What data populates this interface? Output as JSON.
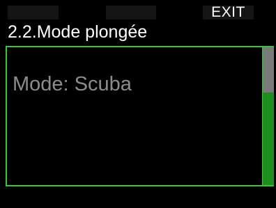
{
  "softkeys": {
    "left_label": "",
    "middle_label": "",
    "right_label": "EXIT"
  },
  "header": {
    "title": "2.2.Mode plongée"
  },
  "content": {
    "mode_text": "Mode: Scuba"
  },
  "scroll": {
    "thumb_fraction": 0.33
  },
  "colors": {
    "background": "#000000",
    "accent": "#3dc43d",
    "scroll_track": "#1e8f1e",
    "scroll_thumb": "#7a7a7a",
    "text_primary": "#ffffff",
    "text_secondary": "#8c8c8c"
  }
}
